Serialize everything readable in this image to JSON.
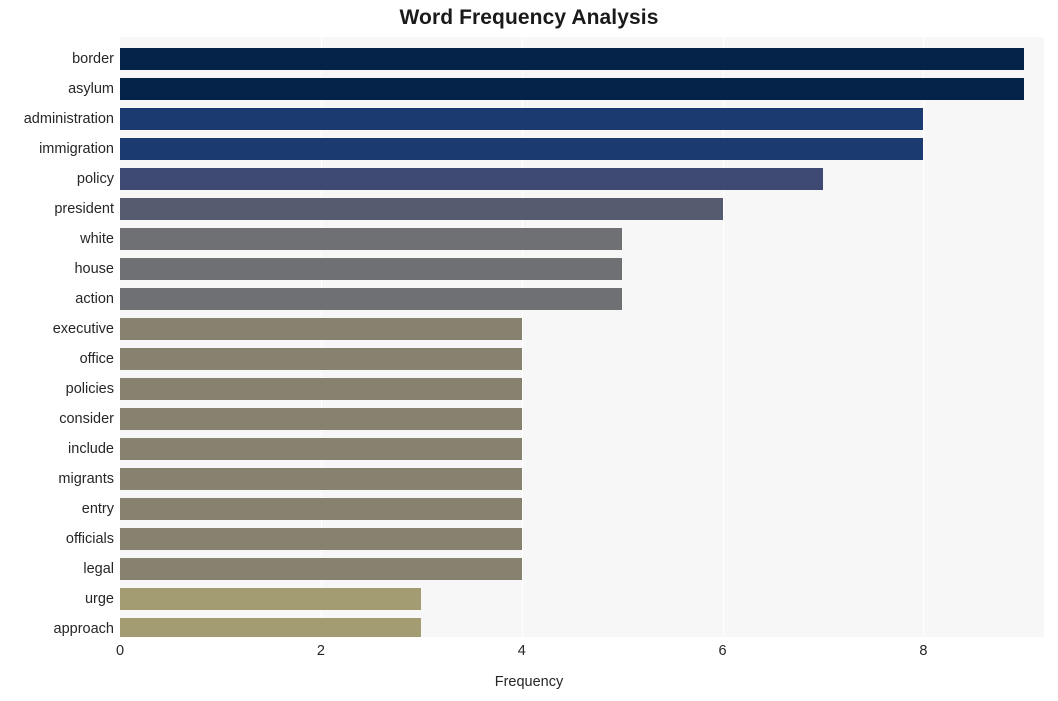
{
  "chart_data": {
    "type": "bar",
    "orientation": "horizontal",
    "title": "Word Frequency Analysis",
    "xlabel": "Frequency",
    "ylabel": "",
    "xlim": [
      0,
      9.2
    ],
    "xticks": [
      0,
      2,
      4,
      6,
      8
    ],
    "xtick_labels": [
      "0",
      "2",
      "4",
      "6",
      "8"
    ],
    "grid": "vertical",
    "legend": "none",
    "categories": [
      "border",
      "asylum",
      "administration",
      "immigration",
      "policy",
      "president",
      "white",
      "house",
      "action",
      "executive",
      "office",
      "policies",
      "consider",
      "include",
      "migrants",
      "entry",
      "officials",
      "legal",
      "urge",
      "approach"
    ],
    "values": [
      9,
      9,
      8,
      8,
      7,
      6,
      5,
      5,
      5,
      4,
      4,
      4,
      4,
      4,
      4,
      4,
      4,
      4,
      3,
      3
    ],
    "bar_colors": [
      "#052249",
      "#052249",
      "#1b3a70",
      "#1b3a70",
      "#3e4a73",
      "#555c70",
      "#6e7074",
      "#6e7074",
      "#6e7074",
      "#87826f",
      "#87826f",
      "#87826f",
      "#87826f",
      "#87826f",
      "#87826f",
      "#87826f",
      "#87826f",
      "#87826f",
      "#a39b72",
      "#a39b72"
    ],
    "plot_background": "#f7f7f7",
    "gridline_color": "#ffffff",
    "figure_background": "#ffffff"
  }
}
